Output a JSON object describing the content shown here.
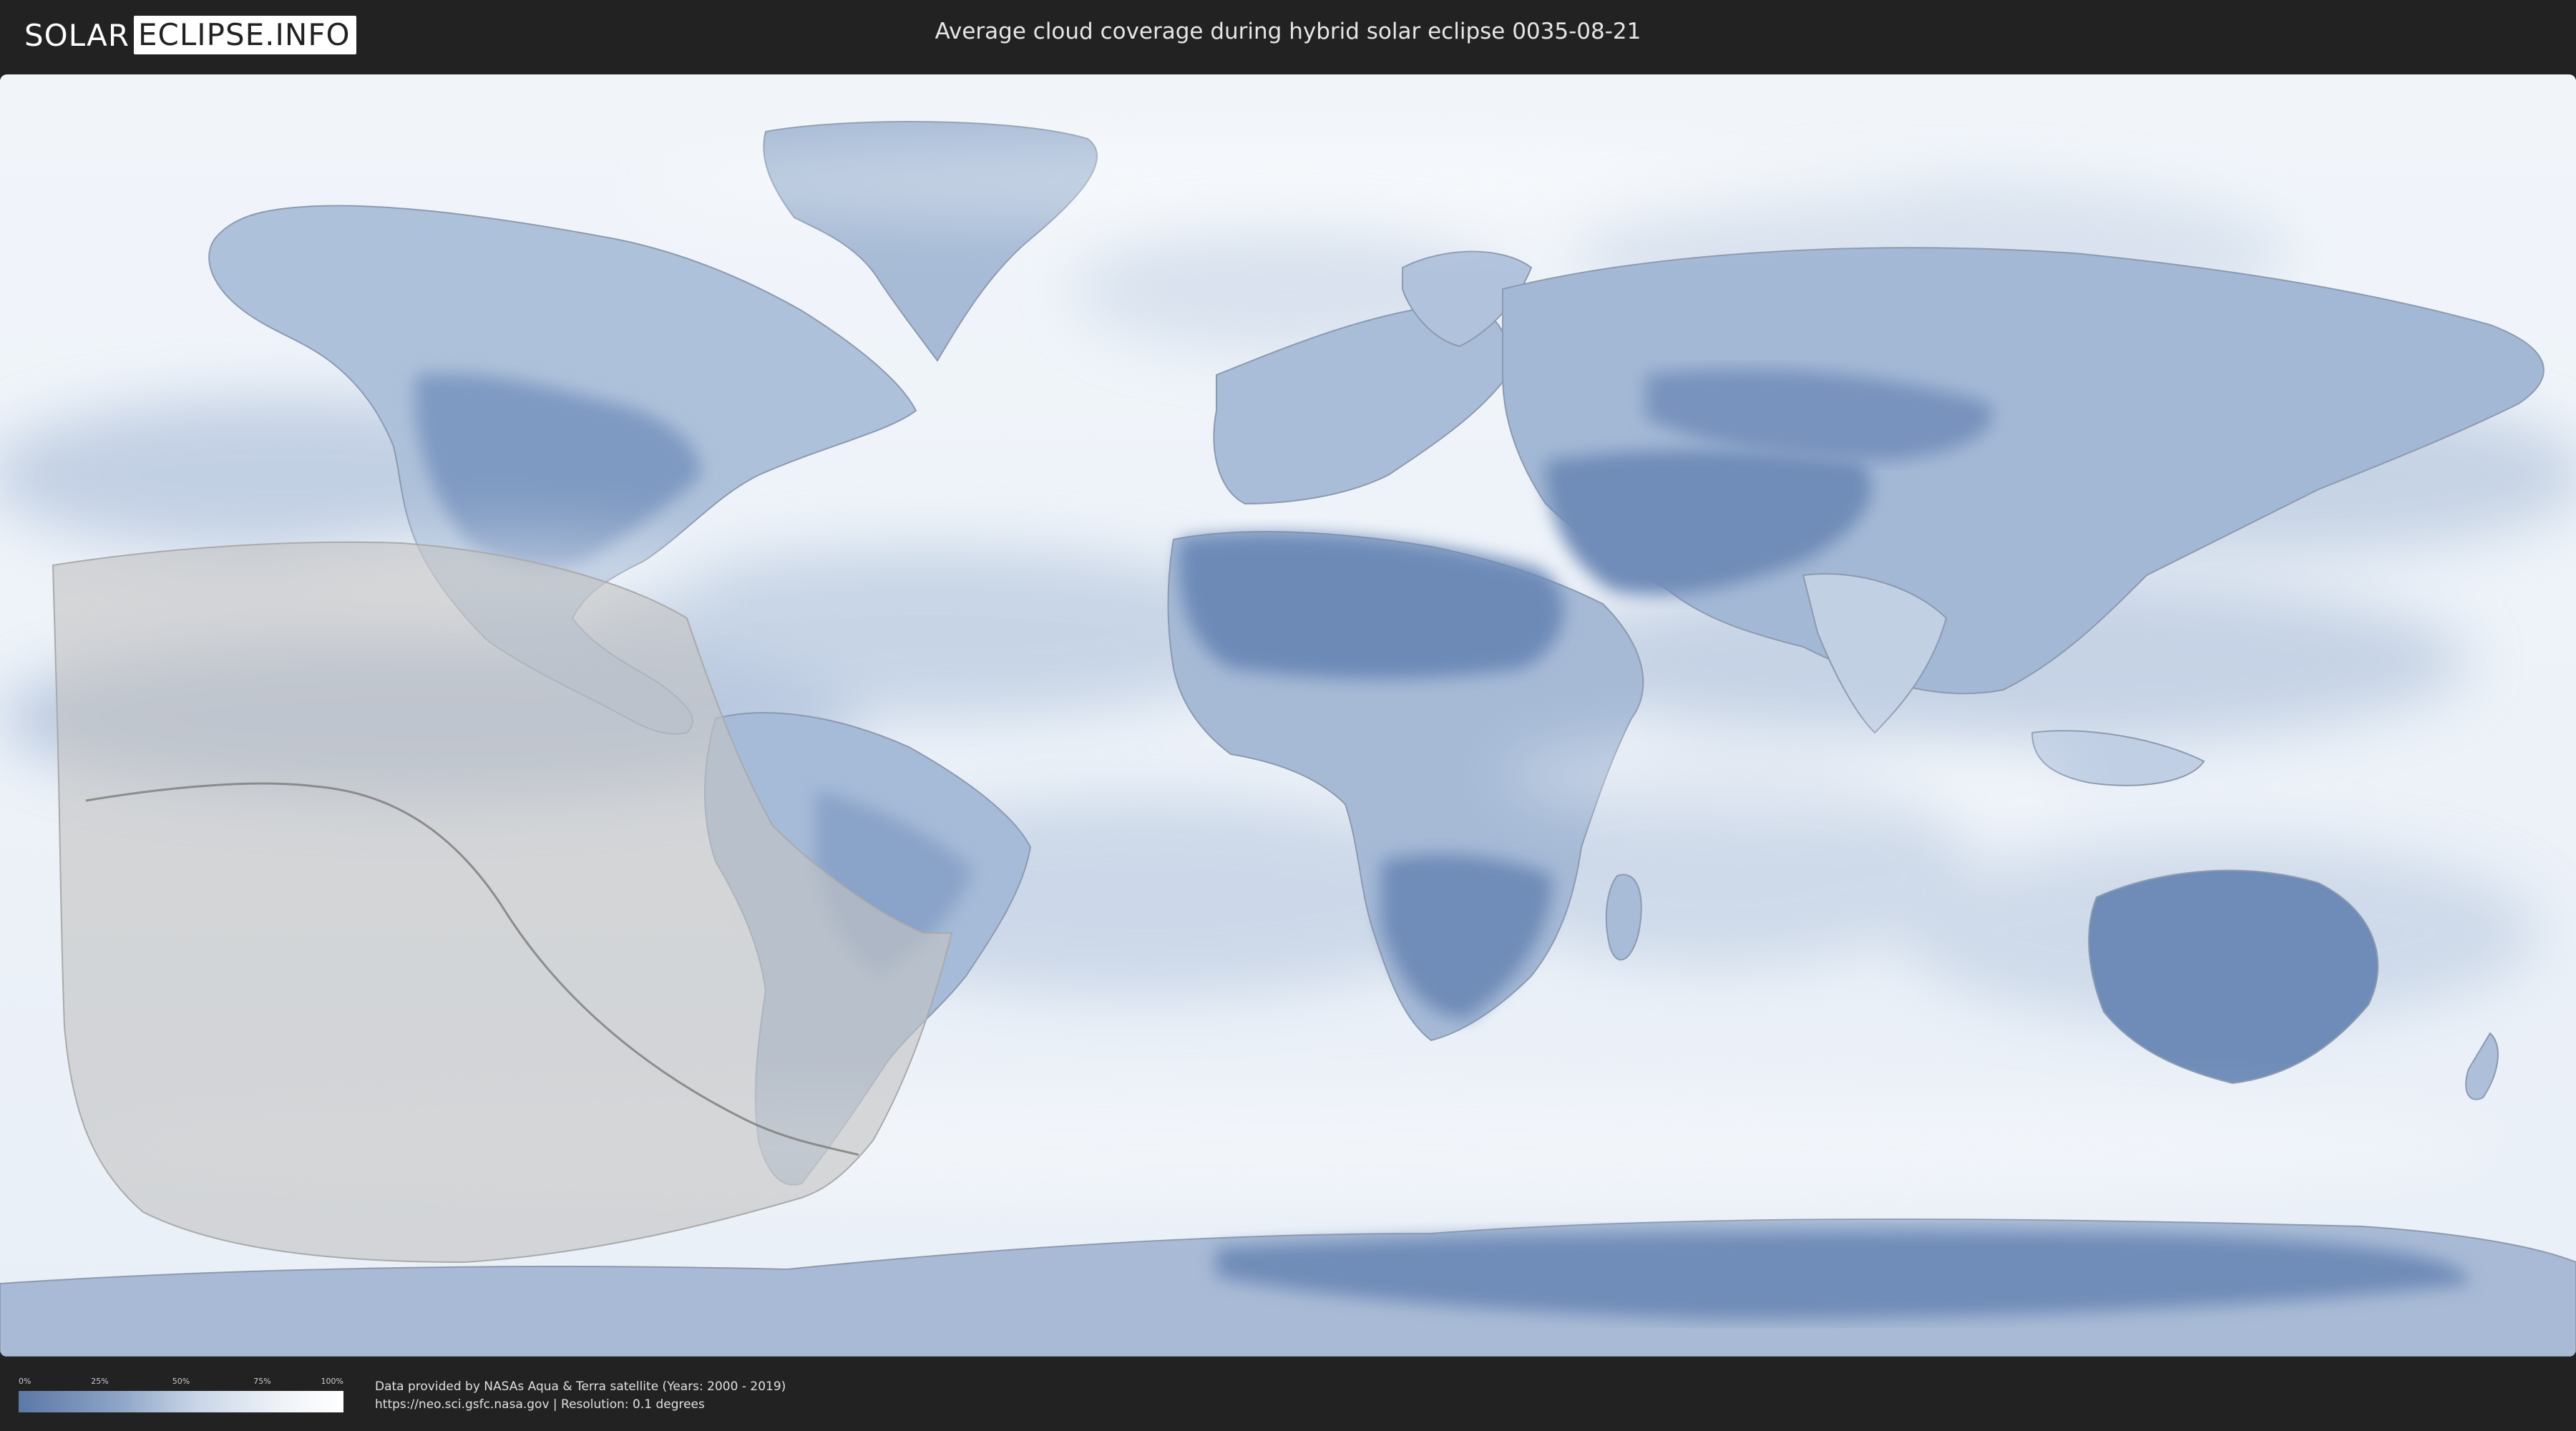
{
  "header": {
    "logo_left": "SOLAR",
    "logo_right": "ECLIPSE.INFO",
    "title": "Average cloud coverage during hybrid solar eclipse 0035-08-21"
  },
  "legend": {
    "ticks": [
      "0%",
      "25%",
      "50%",
      "75%",
      "100%"
    ],
    "color_low": "#5c78a6",
    "color_high": "#ffffff"
  },
  "footer": {
    "source_line1": "Data provided by NASAs Aqua & Terra satellite (Years: 2000 - 2019)",
    "source_line2": "https://neo.sci.gsfc.nasa.gov | Resolution: 0.1 degrees"
  },
  "colors": {
    "background": "#222222",
    "ocean_cloud": "#eef3f9",
    "clear_land": "#6f8db8",
    "eclipse_zone": "#bdbdbd"
  }
}
